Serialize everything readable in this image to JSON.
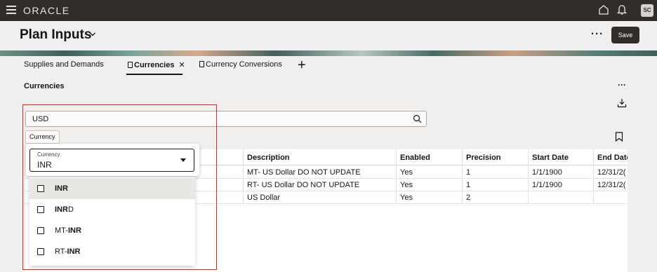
{
  "topbar": {
    "brand": "ORACLE",
    "avatar_initials": "SC"
  },
  "header": {
    "title": "Plan Inputs",
    "more_label": "···",
    "save_label": "Save"
  },
  "tabs": [
    {
      "label": "Supplies and Demands"
    },
    {
      "label": "Currencies",
      "close": "✕"
    },
    {
      "label": "Currency Conversions"
    }
  ],
  "tab_add": "+",
  "section": {
    "title": "Currencies",
    "more_label": "···"
  },
  "search": {
    "value": "USD"
  },
  "filter_chip": "Currency",
  "table": {
    "columns": [
      "Description",
      "Enabled",
      "Precision",
      "Start Date",
      "End Date"
    ],
    "rows": [
      [
        "MT- US Dollar DO NOT UPDATE",
        "Yes",
        "1",
        "1/1/1900",
        "12/31/2("
      ],
      [
        "RT- US Dollar DO NOT UPDATE",
        "Yes",
        "1",
        "1/1/1900",
        "12/31/2("
      ],
      [
        "US Dollar",
        "Yes",
        "2",
        "",
        ""
      ]
    ]
  },
  "currency_filter": {
    "label": "Currency",
    "value": "INR"
  },
  "options": [
    {
      "prefix": "",
      "match": "INR",
      "suffix": ""
    },
    {
      "prefix": "",
      "match": "INR",
      "suffix": "D"
    },
    {
      "prefix": "MT-",
      "match": "INR",
      "suffix": ""
    },
    {
      "prefix": "RT-",
      "match": "INR",
      "suffix": ""
    }
  ],
  "colors": {
    "topbar": "#312d2a",
    "page_bg": "#f1efed",
    "highlight": "#e0251f"
  }
}
